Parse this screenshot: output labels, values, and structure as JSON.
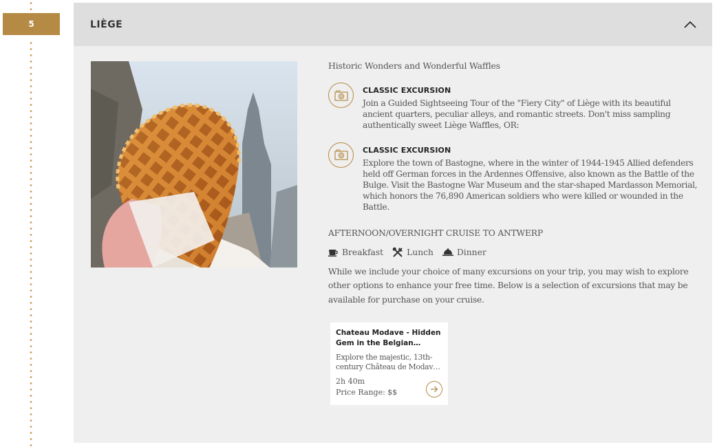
{
  "day": {
    "number": "5"
  },
  "panel": {
    "title": "LIÈGE",
    "subtitle": "Historic Wonders and Wonderful Waffles",
    "excursions": [
      {
        "type": "CLASSIC EXCURSION",
        "description": "Join a Guided Sightseeing Tour of the \"Fiery City\" of Liège with its beautiful ancient quarters, peculiar alleys, and romantic streets. Don't miss sampling authentically sweet Liège Waffles, OR:"
      },
      {
        "type": "CLASSIC EXCURSION",
        "description": "Explore the town of Bastogne, where in the winter of 1944-1945 Allied defenders held off German forces in the Ardennes Offensive, also known as the Battle of the Bulge. Visit the Bastogne War Museum and the star-shaped Mardasson Memorial, which honors the 76,890 American soldiers who were killed or wounded in the Battle."
      }
    ],
    "cruise": "AFTERNOON/OVERNIGHT CRUISE TO ANTWERP",
    "meals": [
      "Breakfast",
      "Lunch",
      "Dinner"
    ],
    "intro": "While we include your choice of many excursions on your trip, you may wish to explore other options to enhance your free time. Below is a selection of excursions that may be available for purchase on your cruise."
  },
  "card": {
    "title": "Chateau Modave - Hidden Gem in the Belgian…",
    "description": "Explore the majestic, 13th-century Château de Modav…",
    "duration": "2h 40m",
    "price_label": "Price Range:",
    "price_value": "$$"
  },
  "icons": {
    "collapse": "chevron-up-icon",
    "excursion": "camera-icon",
    "breakfast": "coffee-cup-icon",
    "lunch": "fork-knife-icon",
    "dinner": "cloche-icon",
    "card_arrow": "arrow-right-icon"
  },
  "colors": {
    "accent": "#b58a44",
    "panel_bg": "#efefef",
    "header_bg": "#dedede"
  }
}
